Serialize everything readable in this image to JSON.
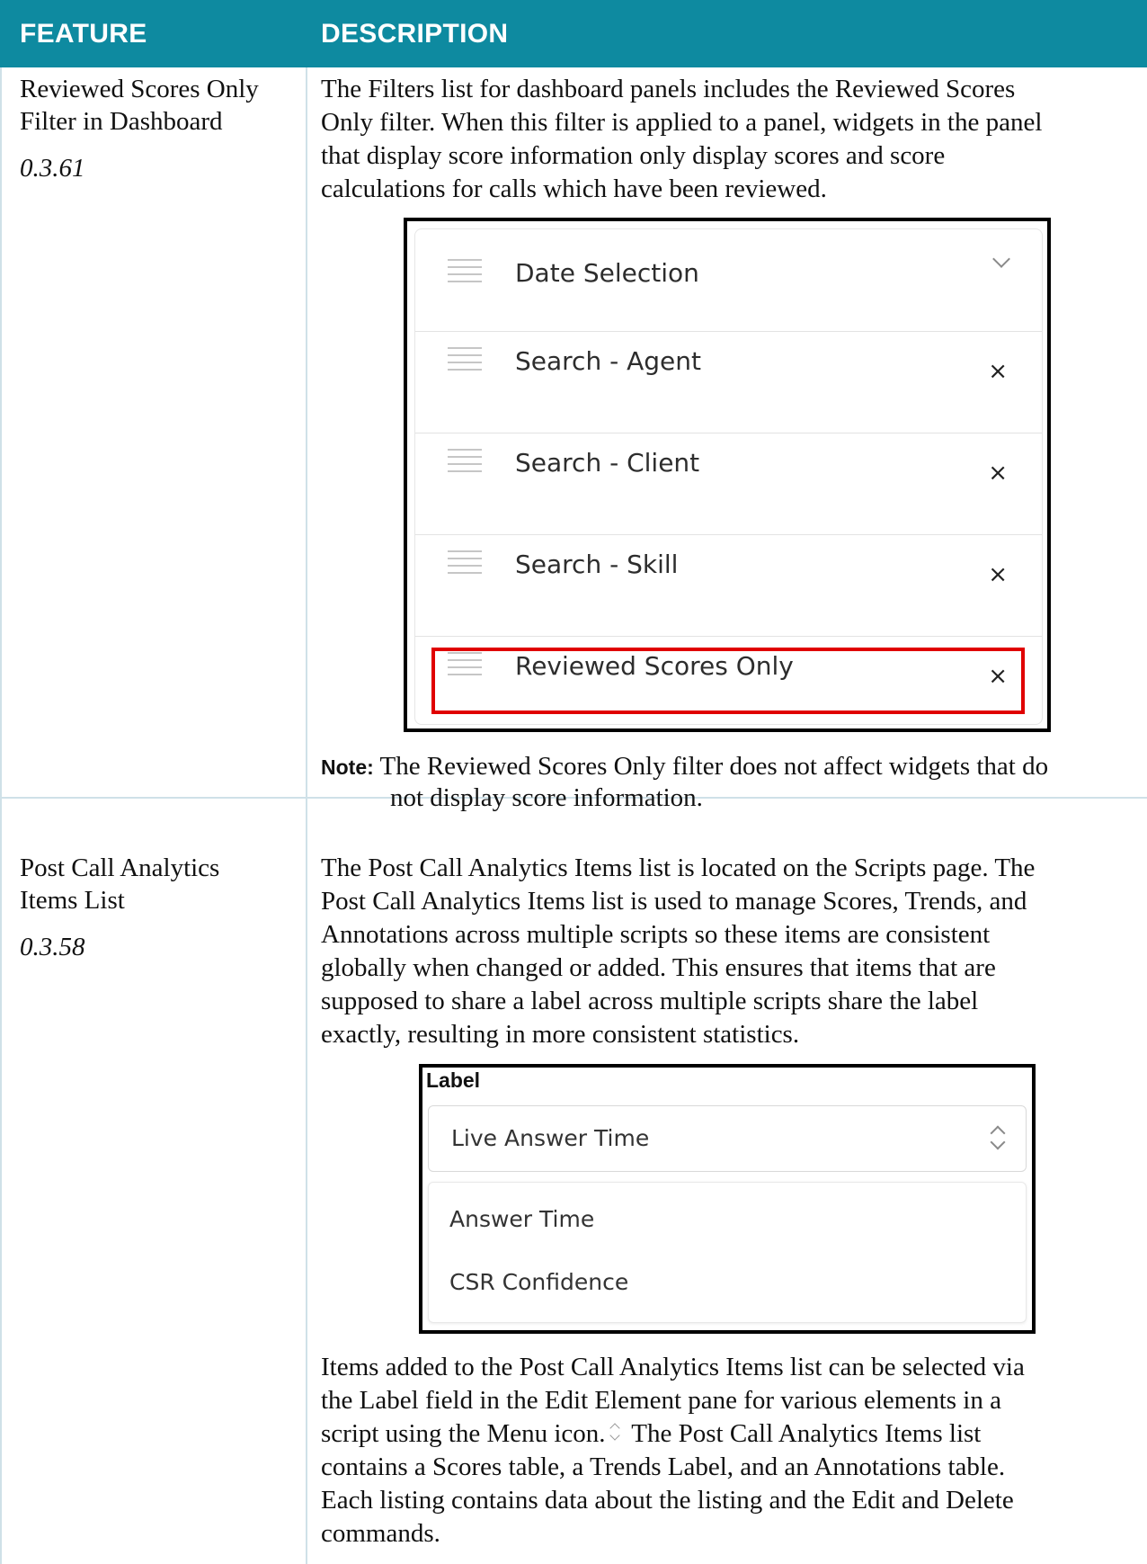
{
  "header": {
    "feature": "FEATURE",
    "description": "DESCRIPTION"
  },
  "rows": [
    {
      "feature_line1": "Reviewed Scores Only",
      "feature_line2": "Filter in Dashboard",
      "version": "0.3.61",
      "desc_lines": [
        "The Filters list for dashboard panels includes the Reviewed Scores",
        "Only filter. When this filter is applied to a panel, widgets in the panel",
        "that display score information only display scores and score",
        "calculations for calls which have been reviewed."
      ],
      "filters": [
        "Date Selection",
        "Search - Agent",
        "Search - Client",
        "Search - Skill",
        "Reviewed Scores Only"
      ],
      "close_glyph": "×",
      "note_label": "Note:",
      "note_line1": " The Reviewed Scores Only filter does not affect widgets that do",
      "note_line2": "not display score information."
    },
    {
      "feature_line1": "Post Call Analytics",
      "feature_line2": "Items List",
      "version": "0.3.58",
      "desc_lines": [
        "The Post Call Analytics Items list is located on the Scripts page. The",
        "Post Call Analytics Items list is used to manage Scores, Trends, and",
        "Annotations across multiple scripts so these items are consistent",
        "globally when changed or added. This ensures that items that are",
        "supposed to share a label across multiple scripts share the label",
        "exactly, resulting in more consistent statistics."
      ],
      "label_title": "Label",
      "selected_value": "Live Answer Time",
      "options": [
        "Answer Time",
        "CSR Confidence"
      ],
      "desc2_lines": [
        "Items added to the Post Call Analytics Items list can be selected via",
        "the Label field in the Edit Element pane for various elements in a",
        "script using the Menu icon.",
        " The Post Call Analytics Items list",
        "contains a Scores table, a Trends Label, and an Annotations table.",
        "Each listing contains data about the listing and the Edit and Delete",
        "commands."
      ]
    }
  ]
}
